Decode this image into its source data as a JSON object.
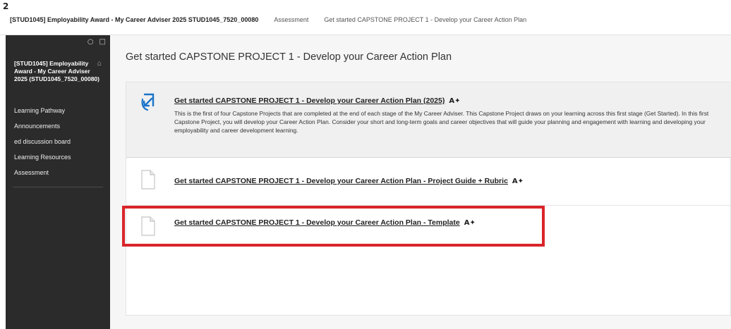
{
  "breadcrumb": {
    "corner_mark": "2",
    "course": "[STUD1045] Employability Award - My Career Adviser 2025 STUD1045_7520_00080",
    "section": "Assessment",
    "current": "Get started CAPSTONE PROJECT 1 - Develop your Career Action Plan"
  },
  "sidebar": {
    "tools": {
      "refresh_icon": "refresh-icon",
      "folder_icon": "folder-icon"
    },
    "course_title": "[STUD1045] Employability Award - My Career Adviser 2025 (STUD1045_7520_00080)",
    "home_icon": "home-icon",
    "items": [
      {
        "label": "Learning Pathway"
      },
      {
        "label": "Announcements"
      },
      {
        "label": "ed discussion board"
      },
      {
        "label": "Learning Resources"
      },
      {
        "label": "Assessment"
      }
    ]
  },
  "main": {
    "title": "Get started CAPSTONE PROJECT 1 - Develop your Career Action Plan",
    "items": [
      {
        "icon": "external-link-icon",
        "title": "Get started CAPSTONE PROJECT 1 - Develop your Career Action Plan (2025)",
        "description": "This is the first of four Capstone Projects that are completed at the end of each stage of the My Career Adviser. This Capstone Project draws on your learning across this first stage (Get Started). In this first Capstone Project, you will develop your Career Action Plan. Consider your short and long-term goals and career objectives that will guide your planning and engagement with learning and developing your employability and career development learning."
      },
      {
        "icon": "document-icon",
        "title": "Get started CAPSTONE PROJECT 1 - Develop your Career Action Plan - Project Guide + Rubric"
      },
      {
        "icon": "document-icon",
        "title": "Get started CAPSTONE PROJECT 1 - Develop your Career Action Plan - Template",
        "highlighted": true
      }
    ]
  },
  "colors": {
    "sidebar_bg": "#2b2b2b",
    "highlight": "#d9252b",
    "link_icon": "#1a73c9"
  }
}
